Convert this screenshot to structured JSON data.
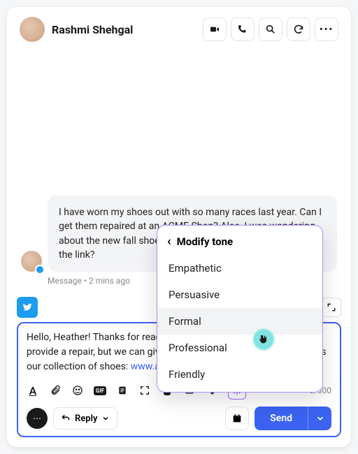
{
  "header": {
    "contact_name": "Rashmi Shehgal"
  },
  "message": {
    "text": "I have worn my shoes out with so many races last year. Can I get them repaired at an ACME Shop? Also, I was wondering about the new fall shoe collection launches. Can you share the link?",
    "meta": "Message • 2 mins ago"
  },
  "compose": {
    "draft_prefix": "Hello, Heather! Thanks for reaching out to us. Unfortunately, we can't provide a repair, but we can give you a discount on a new pair. Here is our collection of shoes: ",
    "draft_link_text": "www.acmeshoes.com/fallcollection",
    "counter": "0/300",
    "reply_label": "Reply",
    "send_label": "Send"
  },
  "popover": {
    "title": "Modify tone",
    "items": [
      "Empathetic",
      "Persuasive",
      "Formal",
      "Professional",
      "Friendly"
    ],
    "hover_index": 2
  }
}
